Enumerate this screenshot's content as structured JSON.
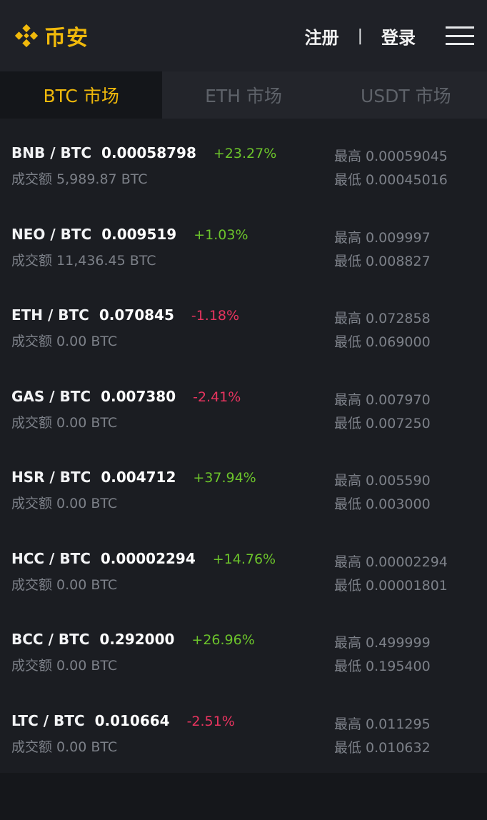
{
  "header": {
    "brand": "币安",
    "register_label": "注册",
    "separator": "|",
    "login_label": "登录",
    "logo_icon": "binance-diamond-icon",
    "menu_icon": "hamburger-menu-icon",
    "brand_color": "#f0b90b"
  },
  "tabs": [
    {
      "label": "BTC 市场",
      "active": true
    },
    {
      "label": "ETH 市场",
      "active": false
    },
    {
      "label": "USDT 市场",
      "active": false
    }
  ],
  "markets": [
    {
      "pair": "BNB / BTC",
      "price": "0.00058798",
      "change": "+23.27%",
      "direction": "up",
      "volume": "成交额 5,989.87 BTC",
      "high": "最高 0.00059045",
      "low": "最低 0.00045016"
    },
    {
      "pair": "NEO / BTC",
      "price": "0.009519",
      "change": "+1.03%",
      "direction": "up",
      "volume": "成交额 11,436.45 BTC",
      "high": "最高 0.009997",
      "low": "最低 0.008827"
    },
    {
      "pair": "ETH / BTC",
      "price": "0.070845",
      "change": "-1.18%",
      "direction": "down",
      "volume": "成交额 0.00 BTC",
      "high": "最高 0.072858",
      "low": "最低 0.069000"
    },
    {
      "pair": "GAS / BTC",
      "price": "0.007380",
      "change": "-2.41%",
      "direction": "down",
      "volume": "成交额 0.00 BTC",
      "high": "最高 0.007970",
      "low": "最低 0.007250"
    },
    {
      "pair": "HSR / BTC",
      "price": "0.004712",
      "change": "+37.94%",
      "direction": "up",
      "volume": "成交额 0.00 BTC",
      "high": "最高 0.005590",
      "low": "最低 0.003000"
    },
    {
      "pair": "HCC / BTC",
      "price": "0.00002294",
      "change": "+14.76%",
      "direction": "up",
      "volume": "成交额 0.00 BTC",
      "high": "最高 0.00002294",
      "low": "最低 0.00001801"
    },
    {
      "pair": "BCC / BTC",
      "price": "0.292000",
      "change": "+26.96%",
      "direction": "up",
      "volume": "成交额 0.00 BTC",
      "high": "最高 0.499999",
      "low": "最低 0.195400"
    },
    {
      "pair": "LTC / BTC",
      "price": "0.010664",
      "change": "-2.51%",
      "direction": "down",
      "volume": "成交额 0.00 BTC",
      "high": "最高 0.011295",
      "low": "最低 0.010632"
    }
  ],
  "colors": {
    "up": "#6cc42b",
    "down": "#e8345f",
    "accent": "#f0b90b"
  }
}
